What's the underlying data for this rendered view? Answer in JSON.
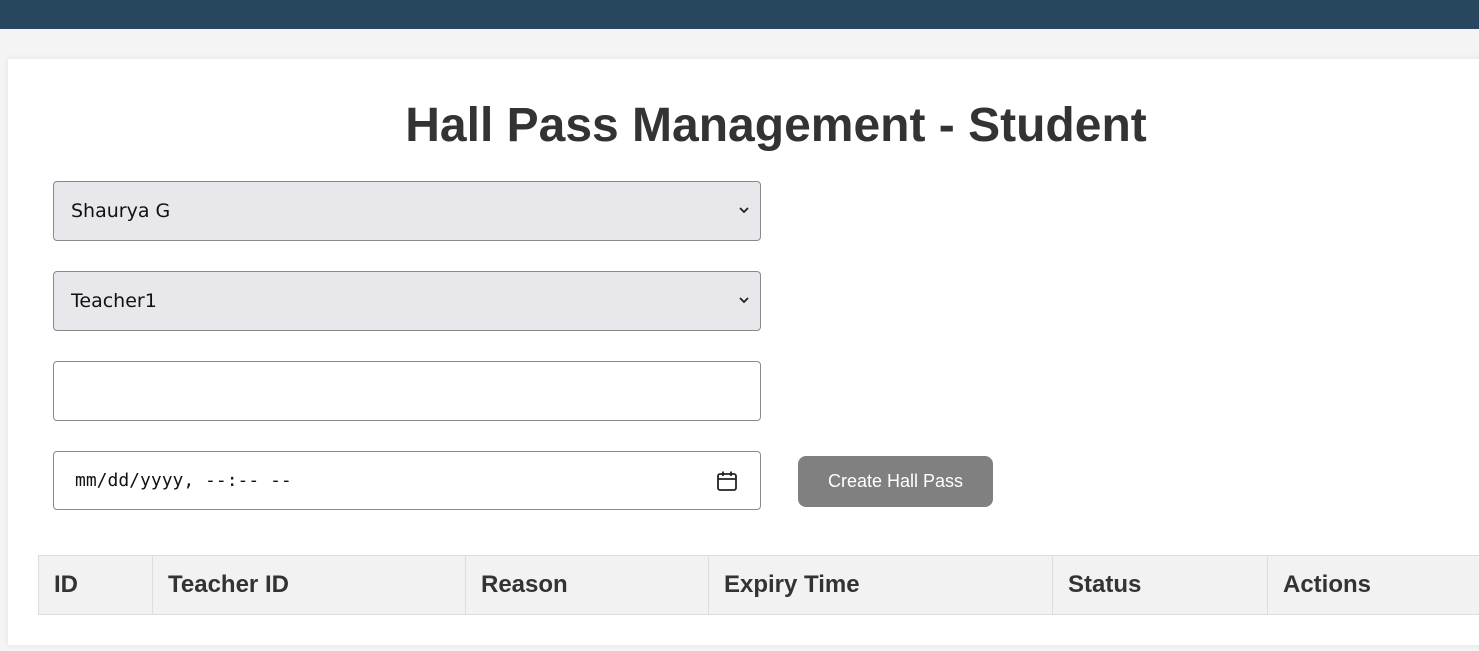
{
  "header": {
    "title": "Hall Pass Management - Student"
  },
  "form": {
    "student_select": {
      "selected": "Shaurya G"
    },
    "teacher_select": {
      "selected": "Teacher1"
    },
    "reason_input": {
      "value": "",
      "placeholder": ""
    },
    "expiry_input": {
      "display": "mm/dd/yyyy, --:-- --"
    },
    "create_button": {
      "label": "Create Hall Pass"
    }
  },
  "table": {
    "columns": [
      "ID",
      "Teacher ID",
      "Reason",
      "Expiry Time",
      "Status",
      "Actions"
    ]
  },
  "colors": {
    "topbar": "#27475e",
    "button": "#808080",
    "select_bg": "#e8e8ec",
    "header_bg": "#f2f2f2"
  },
  "icons": {
    "select_chevron": "chevron-down-icon",
    "date_picker": "calendar-icon"
  }
}
